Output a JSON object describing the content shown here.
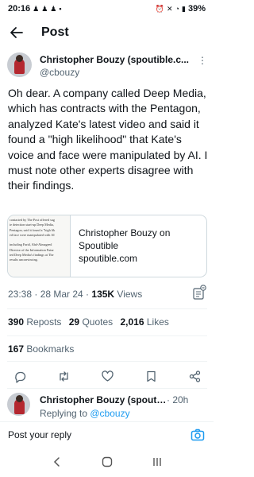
{
  "status_bar": {
    "time": "20:16",
    "battery": "39%"
  },
  "header": {
    "title": "Post",
    "back_icon": "arrow-left-icon"
  },
  "post": {
    "author_name": "Christopher Bouzy (spoutible.c...",
    "author_handle": "@cbouzy",
    "text": "Oh dear. A company called Deep Media, which has contracts with the Pentagon, analyzed Kate's latest video and said it found a \"high likelihood\" that Kate's voice and face were manipulated by AI. I must note other experts disagree with their findings.",
    "link_card": {
      "title_line1": "Christopher Bouzy on",
      "title_line2": "Spoutible",
      "domain": "spoutible.com",
      "thumb_lines": [
        "contacted by The Post offered sug",
        "ie detection start-up Deep Media,",
        "Pentagon, said it found a \"high lik",
        "ed face were manipulated with AI",
        "",
        "including Farid, Abd-Almageed",
        "Director of the Information Futur",
        "ted Deep Media's findings at The",
        "results unconvincing."
      ]
    },
    "timestamp": "23:38 · 28 Mar 24 · ",
    "views_count": "135K",
    "views_label": " Views",
    "reposts_count": "390",
    "reposts_label": "Reposts",
    "quotes_count": "29",
    "quotes_label": "Quotes",
    "likes_count": "2,016",
    "likes_label": "Likes",
    "bookmarks_count": "167",
    "bookmarks_label": "Bookmarks"
  },
  "reply": {
    "author_name": "Christopher Bouzy (spouti...",
    "time": "· 20h",
    "replying_prefix": "Replying to ",
    "replying_handle": "@cbouzy"
  },
  "compose": {
    "placeholder": "Post your reply"
  },
  "colors": {
    "accent": "#1d9bf0",
    "text": "#0f1419",
    "muted": "#536471",
    "border": "#cfd9de"
  }
}
